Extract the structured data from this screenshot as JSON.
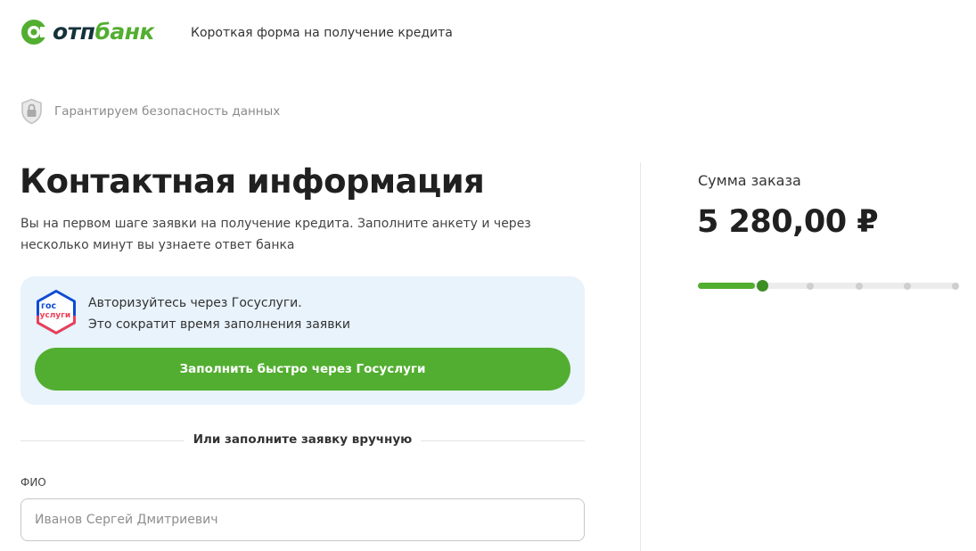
{
  "header": {
    "logo_text_dark": "отп",
    "logo_text_green": "банк",
    "title": "Короткая форма на получение кредита"
  },
  "security": {
    "icon": "shield-lock-icon",
    "text": "Гарантируем безопасность данных"
  },
  "main": {
    "title": "Контактная информация",
    "intro": "Вы на первом шаге заявки на получение кредита. Заполните анкету и через несколько минут вы узнаете ответ банка"
  },
  "gosuslugi": {
    "logo_line1": "гос",
    "logo_line2": "услуги",
    "text_line1": "Авторизуйтесь через Госуслуги.",
    "text_line2": "Это сократит время заполнения заявки",
    "button_label": "Заполнить быстро через Госуслуги"
  },
  "divider": {
    "text": "Или заполните заявку вручную"
  },
  "form": {
    "fio_label": "ФИО",
    "fio_placeholder": "Иванов Сергей Дмитриевич",
    "fio_value": ""
  },
  "order": {
    "label": "Сумма заказа",
    "amount": "5 280,00 ₽"
  },
  "progress": {
    "current_step": 1,
    "total_steps": 5
  },
  "colors": {
    "brand_green": "#52ae30",
    "brand_dark": "#14323b",
    "gos_blue": "#0d4cd3",
    "gos_red": "#ee3f58",
    "card_bg": "#e8f3fb"
  }
}
